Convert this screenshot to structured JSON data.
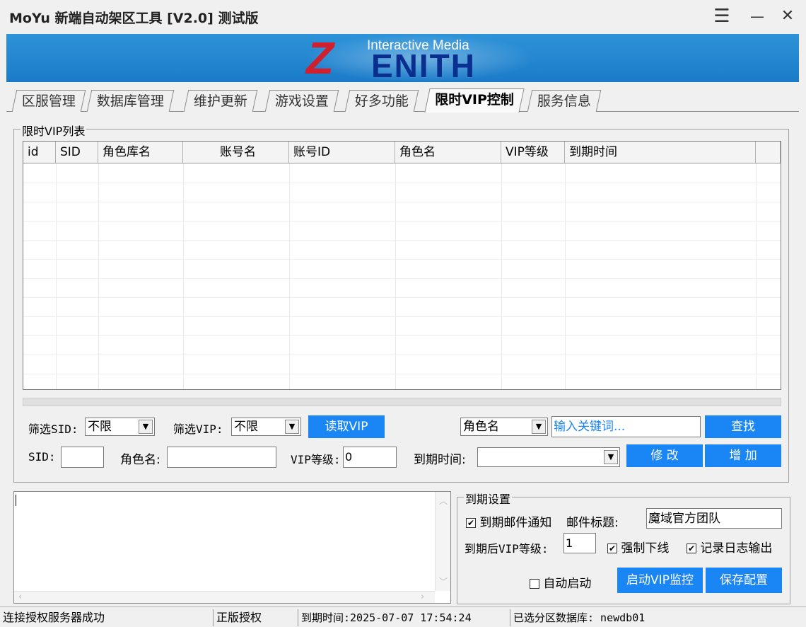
{
  "window": {
    "title": "MoYu 新端自动架区工具 [V2.0] 测试版",
    "menu_icon": "☰",
    "minimize_icon": "—",
    "close_icon": "✕"
  },
  "banner": {
    "logo_sub": "Interactive Media",
    "logo_z": "Z",
    "logo_rest": "ENITH",
    "colors": {
      "bg": "#2a8ad6",
      "z": "#cf2030",
      "text": "#0b2f8f"
    }
  },
  "tabs": [
    {
      "label": "区服管理",
      "active": false
    },
    {
      "label": "数据库管理",
      "active": false
    },
    {
      "label": "维护更新",
      "active": false
    },
    {
      "label": "游戏设置",
      "active": false
    },
    {
      "label": "好多功能",
      "active": false
    },
    {
      "label": "限时VIP控制",
      "active": true
    },
    {
      "label": "服务信息",
      "active": false
    }
  ],
  "vip_list": {
    "group_label": "限时VIP列表",
    "columns": [
      "id",
      "SID",
      "角色库名",
      "账号名",
      "账号ID",
      "角色名",
      "VIP等级",
      "到期时间"
    ],
    "rows": []
  },
  "filters": {
    "sid_label": "筛选SID:",
    "sid_value": "不限",
    "vip_label": "筛选VIP:",
    "vip_value": "不限",
    "read_button": "读取VIP",
    "search_field": "角色名",
    "search_placeholder": "输入关键词...",
    "find_button": "查找"
  },
  "edit": {
    "sid_label": "SID:",
    "sid_value": "",
    "role_label": "角色名:",
    "role_value": "",
    "vip_label": "VIP等级:",
    "vip_value": "0",
    "expire_label": "到期时间:",
    "expire_value": "",
    "modify_button": "修 改",
    "add_button": "增 加"
  },
  "log": {
    "text": ""
  },
  "expire_settings": {
    "group_label": "到期设置",
    "mail_notify_label": "到期邮件通知",
    "mail_notify_checked": true,
    "mail_title_label": "邮件标题:",
    "mail_title_value": "魔域官方团队",
    "after_vip_label": "到期后VIP等级:",
    "after_vip_value": "1",
    "force_offline_label": "强制下线",
    "force_offline_checked": true,
    "log_output_label": "记录日志输出",
    "log_output_checked": true,
    "auto_start_label": "自动启动",
    "auto_start_checked": false,
    "start_monitor_button": "启动VIP监控",
    "save_button": "保存配置",
    "check_mark": "✔"
  },
  "status": {
    "connection": "连接授权服务器成功",
    "license": "正版授权",
    "expire": "到期时间:2025-07-07 17:54:24",
    "db": "已选分区数据库: newdb01"
  },
  "accent_color": "#1a86f5"
}
